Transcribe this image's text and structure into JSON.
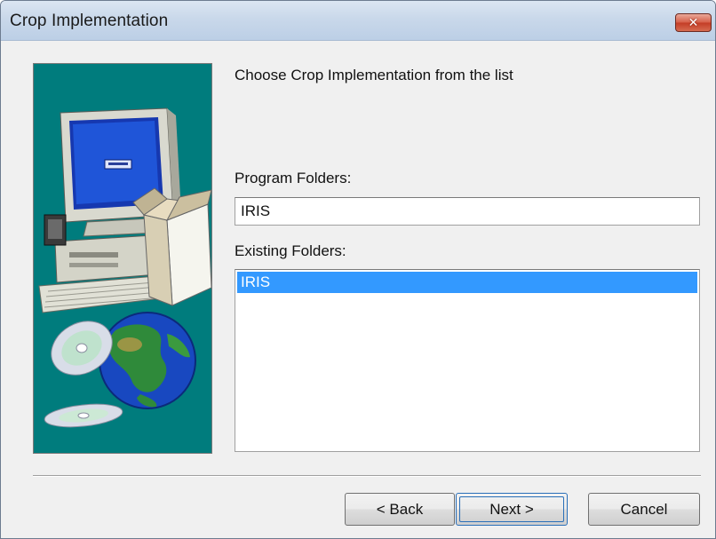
{
  "window": {
    "title": "Crop Implementation",
    "close_glyph": "✕",
    "close_icon": "close-icon"
  },
  "wizard": {
    "instruction": "Choose Crop Implementation from the list",
    "program_folders_label": "Program Folders:",
    "program_folders_value": "IRIS",
    "existing_folders_label": "Existing Folders:",
    "existing_folders": [
      {
        "label": "IRIS",
        "selected": true
      }
    ],
    "artwork": "computer-and-globe-illustration"
  },
  "buttons": {
    "back": "< Back",
    "next": "Next >",
    "cancel": "Cancel"
  },
  "colors": {
    "art_background": "#007c7d",
    "selection": "#3399ff",
    "close_button": "#c43d26"
  }
}
